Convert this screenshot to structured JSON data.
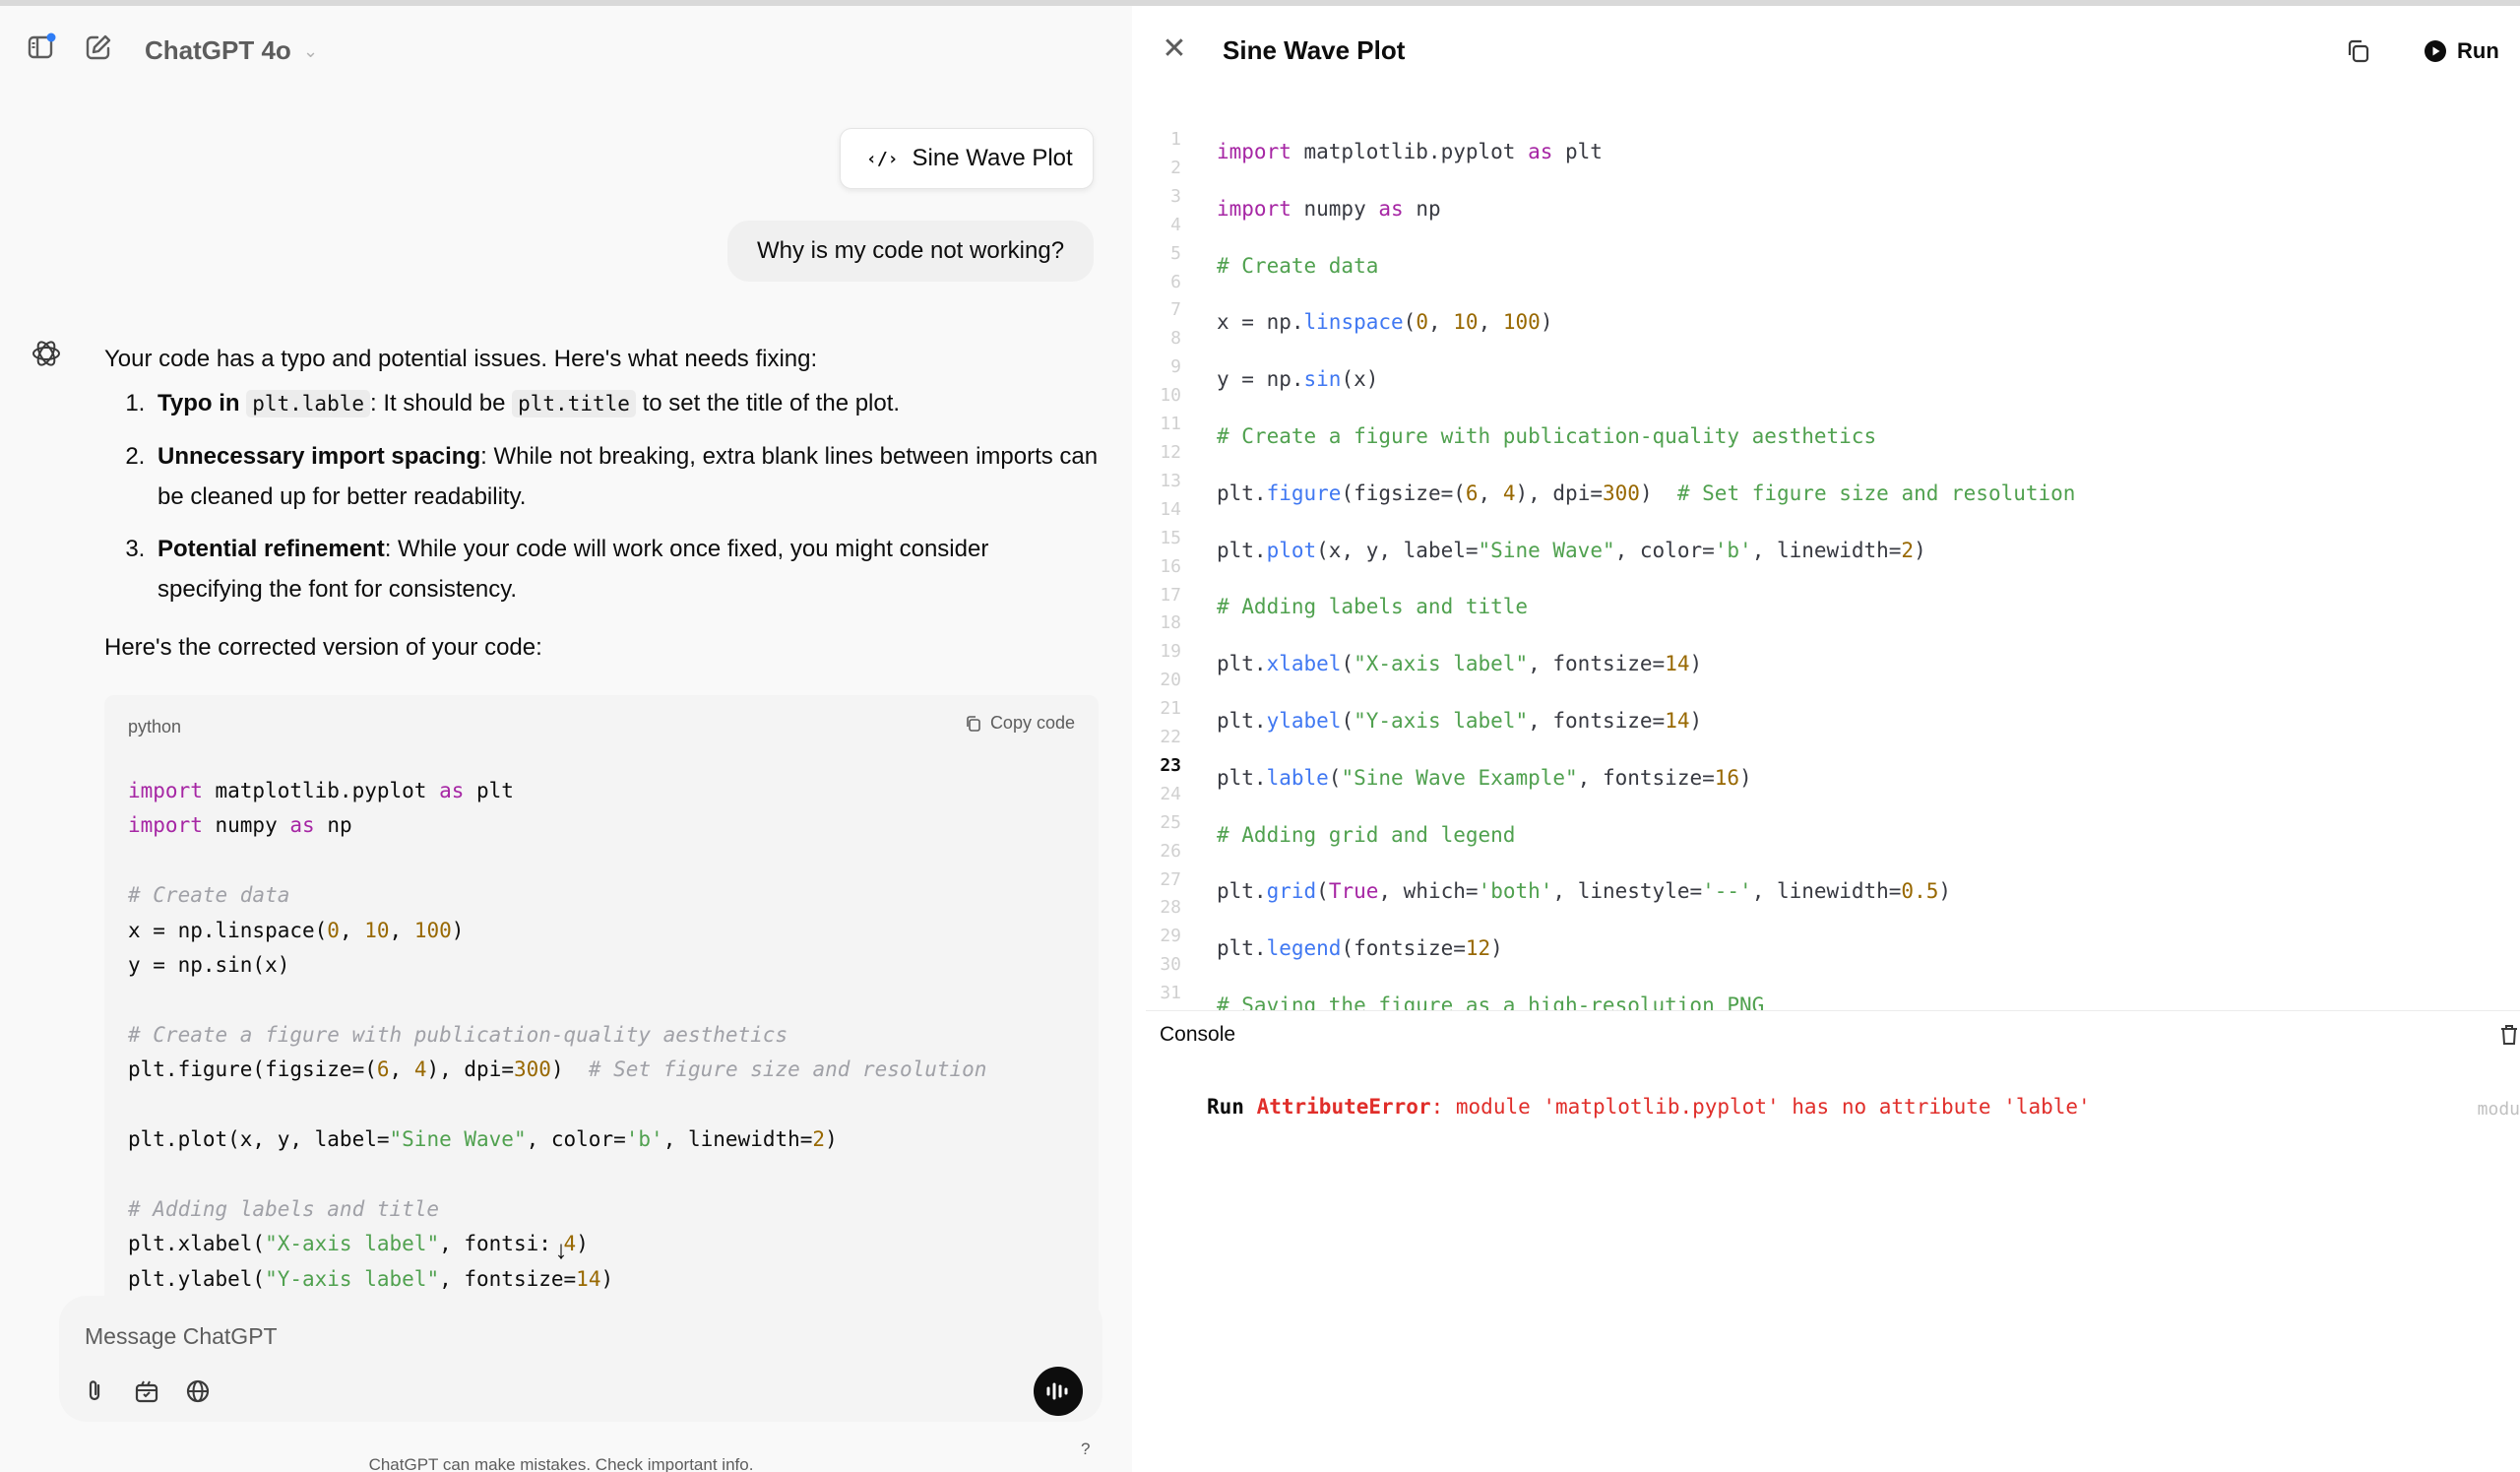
{
  "header": {
    "model": "ChatGPT 4o"
  },
  "chat": {
    "canvas_chip": "Sine Wave Plot",
    "user_message": "Why is my code not working?",
    "intro": "Your code has a typo and potential issues. Here's what needs fixing:",
    "items": [
      {
        "bold": "Typo in",
        "code": "plt.lable",
        "rest1": ": It should be ",
        "code2": "plt.title",
        "rest2": " to set the title of the plot."
      },
      {
        "bold": "Unnecessary import spacing",
        "rest1": ": While not breaking, extra blank lines between imports can be cleaned up for better readability."
      },
      {
        "bold": "Potential refinement",
        "rest1": ": While your code will work once fixed, you might consider specifying the font for consistency."
      }
    ],
    "corrected_intro": "Here's the corrected version of your code:",
    "code_block": {
      "lang": "python",
      "copy_label": "Copy code",
      "lines": [
        "import matplotlib.pyplot as plt",
        "import numpy as np",
        "",
        "# Create data",
        "x = np.linspace(0, 10, 100)",
        "y = np.sin(x)",
        "",
        "# Create a figure with publication-quality aesthetics",
        "plt.figure(figsize=(6, 4), dpi=300)  # Set figure size and resolution",
        "",
        "plt.plot(x, y, label=\"Sine Wave\", color='b', linewidth=2)",
        "",
        "# Adding labels and title",
        "plt.xlabel(\"X-axis label\", fontsi: 4)",
        "plt.ylabel(\"Y-axis label\", fontsize=14)"
      ]
    }
  },
  "composer": {
    "placeholder": "Message ChatGPT"
  },
  "footer": {
    "note": "ChatGPT can make mistakes. Check important info.",
    "help": "?"
  },
  "canvas": {
    "title": "Sine Wave Plot",
    "run_label": "Run",
    "current_line": "23",
    "editor_lines": [
      "import matplotlib.pyplot as plt",
      "import numpy as np",
      "# Create data",
      "x = np.linspace(0, 10, 100)",
      "y = np.sin(x)",
      "# Create a figure with publication-quality aesthetics",
      "plt.figure(figsize=(6, 4), dpi=300)  # Set figure size and resolution",
      "plt.plot(x, y, label=\"Sine Wave\", color='b', linewidth=2)",
      "# Adding labels and title",
      "plt.xlabel(\"X-axis label\", fontsize=14)",
      "plt.ylabel(\"Y-axis label\", fontsize=14)",
      "plt.lable(\"Sine Wave Example\", fontsize=16)",
      "# Adding grid and legend",
      "plt.grid(True, which='both', linestyle='--', linewidth=0.5)",
      "plt.legend(fontsize=12)",
      "# Saving the figure as a high-resolution PNG"
    ],
    "console": {
      "label": "Console",
      "run_tag": "Run",
      "error_type": "AttributeError",
      "error_msg": ": module 'matplotlib.pyplot' has no attribute 'lable'",
      "trunc": "modu"
    }
  },
  "colors": {
    "keyword": "#a626a4",
    "function": "#4078f2",
    "number": "#986801",
    "string": "#50a14f",
    "error": "#e02e2a"
  }
}
